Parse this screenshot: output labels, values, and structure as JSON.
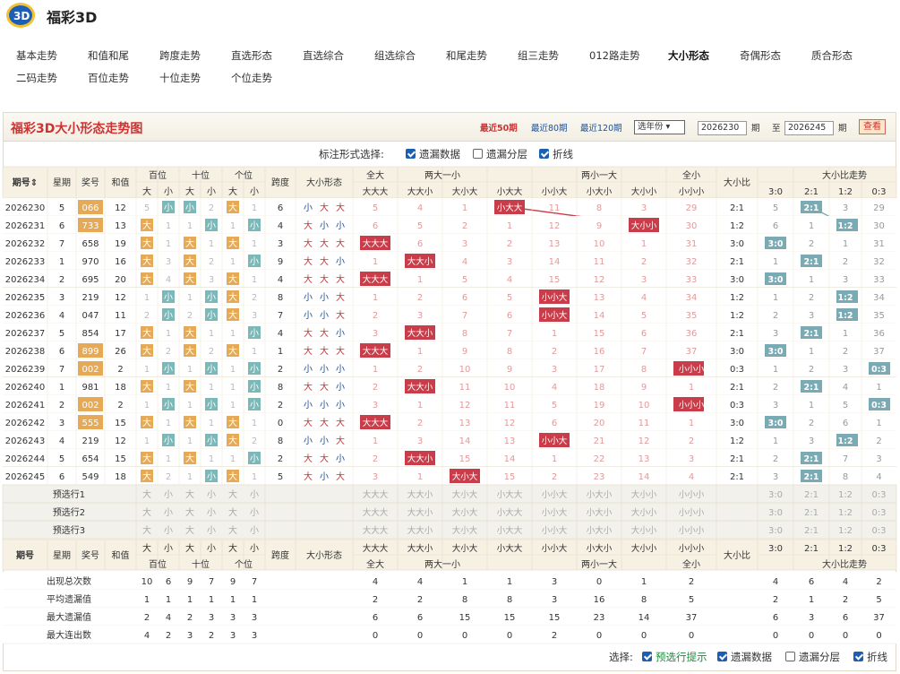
{
  "app": {
    "title": "福彩3D"
  },
  "nav": [
    "基本走势",
    "和值和尾",
    "跨度走势",
    "直选形态",
    "直选综合",
    "组选综合",
    "和尾走势",
    "组三走势",
    "012路走势",
    "大小形态",
    "奇偶形态",
    "质合形态",
    "二码走势",
    "百位走势",
    "十位走势",
    "个位走势"
  ],
  "nav_active": 9,
  "chart": {
    "title": "福彩3D大小形态走势图",
    "recent": [
      "最近50期",
      "最近80期",
      "最近120期"
    ],
    "year_select": "选年份 ▾",
    "from": "2026230",
    "to": "2026245",
    "qi": "期",
    "zhi": "至",
    "view": "查看"
  },
  "options": {
    "label": "标注形式选择:",
    "items": [
      {
        "label": "遗漏数据",
        "checked": true
      },
      {
        "label": "遗漏分层",
        "checked": false
      },
      {
        "label": "折线",
        "checked": true
      }
    ]
  },
  "footer_options": {
    "label": "选择:",
    "items": [
      {
        "label": "预选行提示",
        "checked": true,
        "color": "#1a8a3a"
      },
      {
        "label": "遗漏数据",
        "checked": true
      },
      {
        "label": "遗漏分层",
        "checked": false
      },
      {
        "label": "折线",
        "checked": true
      }
    ]
  },
  "headers": {
    "issue": "期号",
    "week": "星期",
    "prize": "奖号",
    "sum": "和值",
    "hund": "百位",
    "ten": "十位",
    "unit": "个位",
    "big": "大",
    "small": "小",
    "span": "跨度",
    "pattern": "大小形态",
    "g_all_big": "全大",
    "g_two_big": "两大一小",
    "g_two_small": "两小一大",
    "g_all_small": "全小",
    "ratio": "大小比",
    "ratio_trend": "大小比走势",
    "forms": [
      "大大大",
      "大大小",
      "大小大",
      "小大大",
      "小小大",
      "小大小",
      "大小小",
      "小小小"
    ],
    "ratios": [
      "3:0",
      "2:1",
      "1:2",
      "0:3"
    ]
  },
  "rows": [
    {
      "issue": "2026230",
      "week": "5",
      "prize": "066",
      "zu": true,
      "sum": "12",
      "pos": [
        [
          "5",
          "小"
        ],
        [
          "小",
          "2"
        ],
        [
          "大",
          "1"
        ]
      ],
      "span": "6",
      "pattern": [
        "小",
        "大",
        "大"
      ],
      "f": [
        "5",
        "4",
        "1",
        "小大大",
        "11",
        "8",
        "3",
        "29"
      ],
      "ratio": "2:1",
      "r": [
        "5",
        "2:1",
        "3",
        "29"
      ]
    },
    {
      "issue": "2026231",
      "week": "6",
      "prize": "733",
      "zu": true,
      "sum": "13",
      "pos": [
        [
          "大",
          "1"
        ],
        [
          "1",
          "小"
        ],
        [
          "1",
          "小"
        ]
      ],
      "span": "4",
      "pattern": [
        "大",
        "小",
        "小"
      ],
      "f": [
        "6",
        "5",
        "2",
        "1",
        "12",
        "9",
        "大小小",
        "30"
      ],
      "ratio": "1:2",
      "r": [
        "6",
        "1",
        "1:2",
        "30"
      ]
    },
    {
      "issue": "2026232",
      "week": "7",
      "prize": "658",
      "zu": false,
      "sum": "19",
      "pos": [
        [
          "大",
          "1"
        ],
        [
          "大",
          "1"
        ],
        [
          "大",
          "1"
        ]
      ],
      "span": "3",
      "pattern": [
        "大",
        "大",
        "大"
      ],
      "f": [
        "大大大",
        "6",
        "3",
        "2",
        "13",
        "10",
        "1",
        "31"
      ],
      "ratio": "3:0",
      "r": [
        "3:0",
        "2",
        "1",
        "31"
      ]
    },
    {
      "issue": "2026233",
      "week": "1",
      "prize": "970",
      "zu": false,
      "sum": "16",
      "pos": [
        [
          "大",
          "3"
        ],
        [
          "大",
          "2"
        ],
        [
          "1",
          "小"
        ]
      ],
      "span": "9",
      "pattern": [
        "大",
        "大",
        "小"
      ],
      "f": [
        "1",
        "大大小",
        "4",
        "3",
        "14",
        "11",
        "2",
        "32"
      ],
      "ratio": "2:1",
      "r": [
        "1",
        "2:1",
        "2",
        "32"
      ]
    },
    {
      "issue": "2026234",
      "week": "2",
      "prize": "695",
      "zu": false,
      "sum": "20",
      "pos": [
        [
          "大",
          "4"
        ],
        [
          "大",
          "3"
        ],
        [
          "大",
          "1"
        ]
      ],
      "span": "4",
      "pattern": [
        "大",
        "大",
        "大"
      ],
      "f": [
        "大大大",
        "1",
        "5",
        "4",
        "15",
        "12",
        "3",
        "33"
      ],
      "ratio": "3:0",
      "r": [
        "3:0",
        "1",
        "3",
        "33"
      ]
    },
    {
      "issue": "2026235",
      "week": "3",
      "prize": "219",
      "zu": false,
      "sum": "12",
      "pos": [
        [
          "1",
          "小"
        ],
        [
          "1",
          "小"
        ],
        [
          "大",
          "2"
        ]
      ],
      "span": "8",
      "pattern": [
        "小",
        "小",
        "大"
      ],
      "f": [
        "1",
        "2",
        "6",
        "5",
        "小小大",
        "13",
        "4",
        "34"
      ],
      "ratio": "1:2",
      "r": [
        "1",
        "2",
        "1:2",
        "34"
      ]
    },
    {
      "issue": "2026236",
      "week": "4",
      "prize": "047",
      "zu": false,
      "sum": "11",
      "pos": [
        [
          "2",
          "小"
        ],
        [
          "2",
          "小"
        ],
        [
          "大",
          "3"
        ]
      ],
      "span": "7",
      "pattern": [
        "小",
        "小",
        "大"
      ],
      "f": [
        "2",
        "3",
        "7",
        "6",
        "小小大",
        "14",
        "5",
        "35"
      ],
      "ratio": "1:2",
      "r": [
        "2",
        "3",
        "1:2",
        "35"
      ]
    },
    {
      "issue": "2026237",
      "week": "5",
      "prize": "854",
      "zu": false,
      "sum": "17",
      "pos": [
        [
          "大",
          "1"
        ],
        [
          "大",
          "1"
        ],
        [
          "1",
          "小"
        ]
      ],
      "span": "4",
      "pattern": [
        "大",
        "大",
        "小"
      ],
      "f": [
        "3",
        "大大小",
        "8",
        "7",
        "1",
        "15",
        "6",
        "36"
      ],
      "ratio": "2:1",
      "r": [
        "3",
        "2:1",
        "1",
        "36"
      ]
    },
    {
      "issue": "2026238",
      "week": "6",
      "prize": "899",
      "zu": true,
      "sum": "26",
      "pos": [
        [
          "大",
          "2"
        ],
        [
          "大",
          "2"
        ],
        [
          "大",
          "1"
        ]
      ],
      "span": "1",
      "pattern": [
        "大",
        "大",
        "大"
      ],
      "f": [
        "大大大",
        "1",
        "9",
        "8",
        "2",
        "16",
        "7",
        "37"
      ],
      "ratio": "3:0",
      "r": [
        "3:0",
        "1",
        "2",
        "37"
      ]
    },
    {
      "issue": "2026239",
      "week": "7",
      "prize": "002",
      "zu": true,
      "sum": "2",
      "pos": [
        [
          "1",
          "小"
        ],
        [
          "1",
          "小"
        ],
        [
          "1",
          "小"
        ]
      ],
      "span": "2",
      "pattern": [
        "小",
        "小",
        "小"
      ],
      "f": [
        "1",
        "2",
        "10",
        "9",
        "3",
        "17",
        "8",
        "小小小"
      ],
      "ratio": "0:3",
      "r": [
        "1",
        "2",
        "3",
        "0:3"
      ]
    },
    {
      "issue": "2026240",
      "week": "1",
      "prize": "981",
      "zu": false,
      "sum": "18",
      "pos": [
        [
          "大",
          "1"
        ],
        [
          "大",
          "1"
        ],
        [
          "1",
          "小"
        ]
      ],
      "span": "8",
      "pattern": [
        "大",
        "大",
        "小"
      ],
      "f": [
        "2",
        "大大小",
        "11",
        "10",
        "4",
        "18",
        "9",
        "1"
      ],
      "ratio": "2:1",
      "r": [
        "2",
        "2:1",
        "4",
        "1"
      ]
    },
    {
      "issue": "2026241",
      "week": "2",
      "prize": "002",
      "zu": true,
      "sum": "2",
      "pos": [
        [
          "1",
          "小"
        ],
        [
          "1",
          "小"
        ],
        [
          "1",
          "小"
        ]
      ],
      "span": "2",
      "pattern": [
        "小",
        "小",
        "小"
      ],
      "f": [
        "3",
        "1",
        "12",
        "11",
        "5",
        "19",
        "10",
        "小小小"
      ],
      "ratio": "0:3",
      "r": [
        "3",
        "1",
        "5",
        "0:3"
      ]
    },
    {
      "issue": "2026242",
      "week": "3",
      "prize": "555",
      "zu": true,
      "sum": "15",
      "pos": [
        [
          "大",
          "1"
        ],
        [
          "大",
          "1"
        ],
        [
          "大",
          "1"
        ]
      ],
      "span": "0",
      "pattern": [
        "大",
        "大",
        "大"
      ],
      "f": [
        "大大大",
        "2",
        "13",
        "12",
        "6",
        "20",
        "11",
        "1"
      ],
      "ratio": "3:0",
      "r": [
        "3:0",
        "2",
        "6",
        "1"
      ]
    },
    {
      "issue": "2026243",
      "week": "4",
      "prize": "219",
      "zu": false,
      "sum": "12",
      "pos": [
        [
          "1",
          "小"
        ],
        [
          "1",
          "小"
        ],
        [
          "大",
          "2"
        ]
      ],
      "span": "8",
      "pattern": [
        "小",
        "小",
        "大"
      ],
      "f": [
        "1",
        "3",
        "14",
        "13",
        "小小大",
        "21",
        "12",
        "2"
      ],
      "ratio": "1:2",
      "r": [
        "1",
        "3",
        "1:2",
        "2"
      ]
    },
    {
      "issue": "2026244",
      "week": "5",
      "prize": "654",
      "zu": false,
      "sum": "15",
      "pos": [
        [
          "大",
          "1"
        ],
        [
          "大",
          "1"
        ],
        [
          "1",
          "小"
        ]
      ],
      "span": "2",
      "pattern": [
        "大",
        "大",
        "小"
      ],
      "f": [
        "2",
        "大大小",
        "15",
        "14",
        "1",
        "22",
        "13",
        "3"
      ],
      "ratio": "2:1",
      "r": [
        "2",
        "2:1",
        "7",
        "3"
      ]
    },
    {
      "issue": "2026245",
      "week": "6",
      "prize": "549",
      "zu": false,
      "sum": "18",
      "pos": [
        [
          "大",
          "2"
        ],
        [
          "1",
          "小"
        ],
        [
          "大",
          "1"
        ]
      ],
      "span": "5",
      "pattern": [
        "大",
        "小",
        "大"
      ],
      "f": [
        "3",
        "1",
        "大小大",
        "15",
        "2",
        "23",
        "14",
        "4"
      ],
      "ratio": "2:1",
      "r": [
        "3",
        "2:1",
        "8",
        "4"
      ]
    }
  ],
  "preselect": [
    "预选行1",
    "预选行2",
    "预选行3"
  ],
  "stats": [
    {
      "label": "出现总次数",
      "pos": [
        "10",
        "6",
        "9",
        "7",
        "9",
        "7"
      ],
      "f": [
        "4",
        "4",
        "1",
        "1",
        "3",
        "0",
        "1",
        "2"
      ],
      "r": [
        "4",
        "6",
        "4",
        "2"
      ]
    },
    {
      "label": "平均遗漏值",
      "pos": [
        "1",
        "1",
        "1",
        "1",
        "1",
        "1"
      ],
      "f": [
        "2",
        "2",
        "8",
        "8",
        "3",
        "16",
        "8",
        "5"
      ],
      "r": [
        "2",
        "1",
        "2",
        "5"
      ]
    },
    {
      "label": "最大遗漏值",
      "pos": [
        "2",
        "4",
        "2",
        "3",
        "3",
        "3"
      ],
      "f": [
        "6",
        "6",
        "15",
        "15",
        "15",
        "23",
        "14",
        "37"
      ],
      "r": [
        "6",
        "3",
        "6",
        "37"
      ]
    },
    {
      "label": "最大连出数",
      "pos": [
        "4",
        "2",
        "3",
        "2",
        "3",
        "3"
      ],
      "f": [
        "0",
        "0",
        "0",
        "0",
        "2",
        "0",
        "0",
        "0"
      ],
      "r": [
        "0",
        "0",
        "0",
        "0"
      ]
    }
  ]
}
